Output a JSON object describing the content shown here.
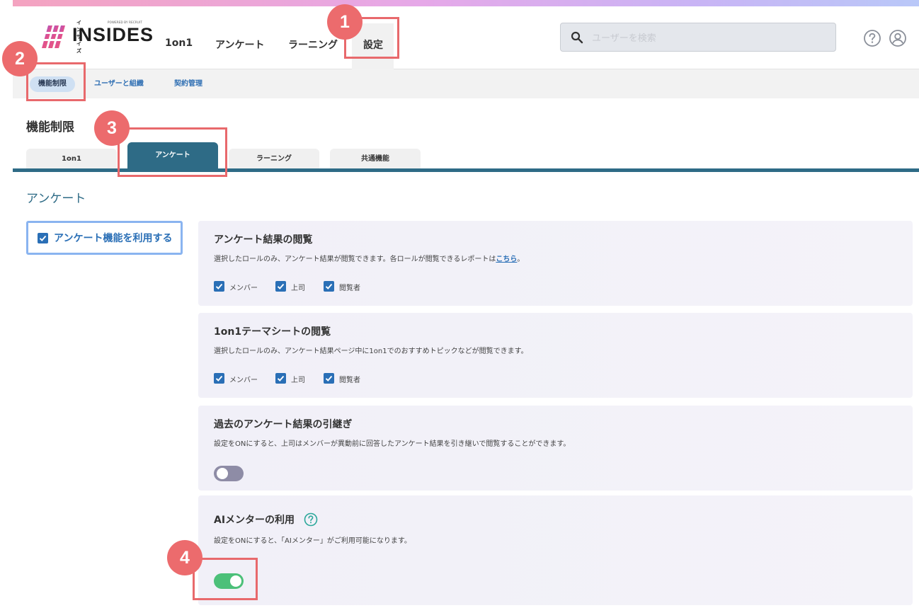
{
  "header": {
    "logo": {
      "kana": "インサイズ",
      "powered": "POWERED BY RECRUIT",
      "name": "INSIDES"
    },
    "nav": [
      {
        "label": "1on1"
      },
      {
        "label": "アンケート"
      },
      {
        "label": "ラーニング"
      },
      {
        "label": "設定",
        "active": true
      }
    ],
    "search": {
      "placeholder": "ユーザーを検索",
      "value": ""
    },
    "icons": [
      "help-icon",
      "user-account-icon"
    ]
  },
  "subnav": {
    "items": [
      {
        "label": "機能制限",
        "active": true
      },
      {
        "label": "ユーザーと組織"
      },
      {
        "label": "契約管理"
      }
    ]
  },
  "page": {
    "title": "機能制限",
    "tabs": [
      {
        "label": "1on1"
      },
      {
        "label": "アンケート",
        "active": true
      },
      {
        "label": "ラーニング"
      },
      {
        "label": "共通機能"
      }
    ],
    "section_title": "アンケート",
    "enable": {
      "label": "アンケート機能を利用する",
      "checked": true
    }
  },
  "panels": [
    {
      "title": "アンケート結果の閲覧",
      "desc": "選択したロールのみ、アンケート結果が閲覧できます。各ロールが閲覧できるレポートは",
      "desc_link": "こちら",
      "desc_end": "。",
      "options": [
        {
          "label": "メンバー",
          "checked": true
        },
        {
          "label": "上司",
          "checked": true
        },
        {
          "label": "閲覧者",
          "checked": true
        }
      ]
    },
    {
      "title": "1on1テーマシートの閲覧",
      "desc": "選択したロールのみ、アンケート結果ページ中に1on1でのおすすめトピックなどが閲覧できます。",
      "options": [
        {
          "label": "メンバー",
          "checked": true
        },
        {
          "label": "上司",
          "checked": true
        },
        {
          "label": "閲覧者",
          "checked": true
        }
      ]
    },
    {
      "title": "過去のアンケート結果の引継ぎ",
      "desc": "設定をONにすると、上司はメンバーが異動前に回答したアンケート結果を引き継いで閲覧することができます。",
      "toggle": false
    },
    {
      "title": "AIメンターの利用",
      "desc": "設定をONにすると、「AIメンター」がご利用可能になります。",
      "toggle": true
    }
  ],
  "annotations": [
    "1",
    "2",
    "3",
    "4"
  ],
  "colors": {
    "accent": "#2e6b86",
    "link": "#2a6fb6",
    "toggle_on": "#4cc079",
    "toggle_off": "#8e8ca6",
    "annotation": "#ec6b6d"
  }
}
